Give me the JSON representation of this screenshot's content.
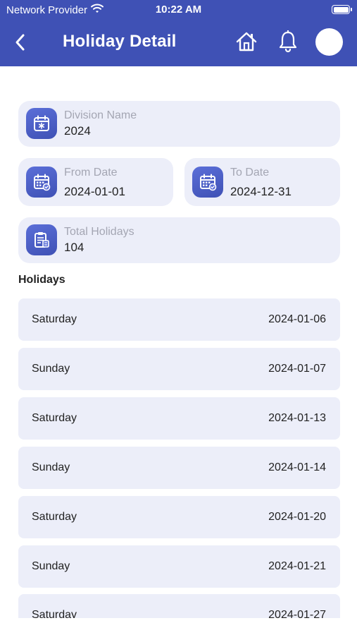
{
  "status_bar": {
    "carrier": "Network Provider",
    "time": "10:22 AM",
    "wifi_icon": "wifi-icon",
    "battery_icon": "battery-icon"
  },
  "header": {
    "title": "Holiday Detail",
    "back_icon": "chevron-left-icon",
    "home_icon": "home-icon",
    "bell_icon": "bell-icon",
    "background": "#3f51b5"
  },
  "details": {
    "division": {
      "label": "Division Name",
      "value": "2024",
      "icon": "calendar-icon"
    },
    "from_date": {
      "label": "From Date",
      "value": "2024-01-01",
      "icon": "calendar-check-icon"
    },
    "to_date": {
      "label": "To Date",
      "value": "2024-12-31",
      "icon": "calendar-check-icon"
    },
    "total_holidays": {
      "label": "Total Holidays",
      "value": "104",
      "icon": "clipboard-list-icon"
    }
  },
  "holidays_section": {
    "title": "Holidays",
    "items": [
      {
        "day": "Saturday",
        "date": "2024-01-06"
      },
      {
        "day": "Sunday",
        "date": "2024-01-07"
      },
      {
        "day": "Saturday",
        "date": "2024-01-13"
      },
      {
        "day": "Sunday",
        "date": "2024-01-14"
      },
      {
        "day": "Saturday",
        "date": "2024-01-20"
      },
      {
        "day": "Sunday",
        "date": "2024-01-21"
      },
      {
        "day": "Saturday",
        "date": "2024-01-27"
      }
    ]
  },
  "colors": {
    "primary": "#3f51b5",
    "card_background": "#eceef9",
    "muted_text": "#a4a6b3"
  }
}
